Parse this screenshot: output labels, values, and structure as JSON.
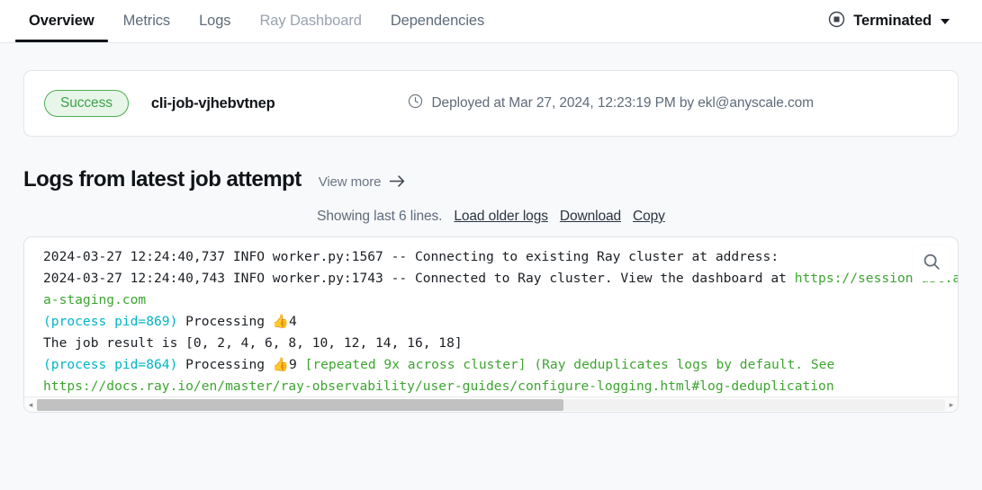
{
  "tabs": [
    {
      "label": "Overview",
      "state": "active"
    },
    {
      "label": "Metrics",
      "state": "normal"
    },
    {
      "label": "Logs",
      "state": "normal"
    },
    {
      "label": "Ray Dashboard",
      "state": "muted"
    },
    {
      "label": "Dependencies",
      "state": "normal"
    }
  ],
  "status": {
    "label": "Terminated",
    "icon": "stop-circle-icon"
  },
  "job_card": {
    "badge": "Success",
    "badge_color": "#3fa04a",
    "badge_bg": "#e8f6ea",
    "name": "cli-job-vjhebvtnep",
    "deployed_text": "Deployed at Mar 27, 2024, 12:23:19 PM by ekl@anyscale.com",
    "clock_icon": "clock-icon"
  },
  "logs_section": {
    "title": "Logs from latest job attempt",
    "view_more": "View more",
    "view_more_icon": "arrow-right-icon",
    "showing_text": "Showing last 6 lines.",
    "load_older": "Load older logs",
    "download": "Download",
    "copy": "Copy",
    "search_icon": "search-icon",
    "colors": {
      "green": "#3ea531",
      "cyan": "#00b5c6",
      "plain": "#1b1f24"
    },
    "lines": [
      {
        "segments": [
          {
            "text": "2024-03-27 12:24:40,737 INFO worker.py:1567 -- Connecting to existing Ray cluster at addr",
            "color": "plain"
          },
          {
            "text": "ess: ",
            "color": "plain"
          }
        ]
      },
      {
        "segments": [
          {
            "text": "2024-03-27 12:24:40,743 INFO worker.py:1743 -- Connected to Ray cluster. View the dashboard a",
            "color": "plain"
          },
          {
            "text": "t ",
            "color": "plain"
          },
          {
            "text": "https://session-abc.anyscal",
            "color": "green"
          }
        ]
      },
      {
        "segments": [
          {
            "text": "a-staging.com",
            "color": "green"
          }
        ]
      },
      {
        "segments": [
          {
            "text": "(process pid=869)",
            "color": "cyan"
          },
          {
            "text": " Processing ",
            "color": "plain"
          },
          {
            "text": "👍",
            "color": "plain"
          },
          {
            "text": "4",
            "color": "plain"
          }
        ]
      },
      {
        "segments": [
          {
            "text": "The job result is [0, 2, 4, 6, 8, 10, 12, 14, 16, 18]",
            "color": "plain"
          }
        ]
      },
      {
        "segments": [
          {
            "text": "(process pid=864)",
            "color": "cyan"
          },
          {
            "text": " Processing ",
            "color": "plain"
          },
          {
            "text": "👍",
            "color": "plain"
          },
          {
            "text": "9 ",
            "color": "plain"
          },
          {
            "text": "[repeated 9x across cluster] (Ray deduplicates logs by defau",
            "color": "green"
          },
          {
            "text": "lt. See",
            "color": "green"
          }
        ]
      },
      {
        "segments": [
          {
            "text": "https://docs.ray.io/en/master/ray-observability/user-guides/configure-logging.html#log-dedupl",
            "color": "green"
          },
          {
            "text": "ication",
            "color": "green"
          }
        ]
      }
    ]
  },
  "scrollbar": {
    "thumb_percent": 58,
    "left_arrow": "◂",
    "right_arrow": "▸"
  }
}
